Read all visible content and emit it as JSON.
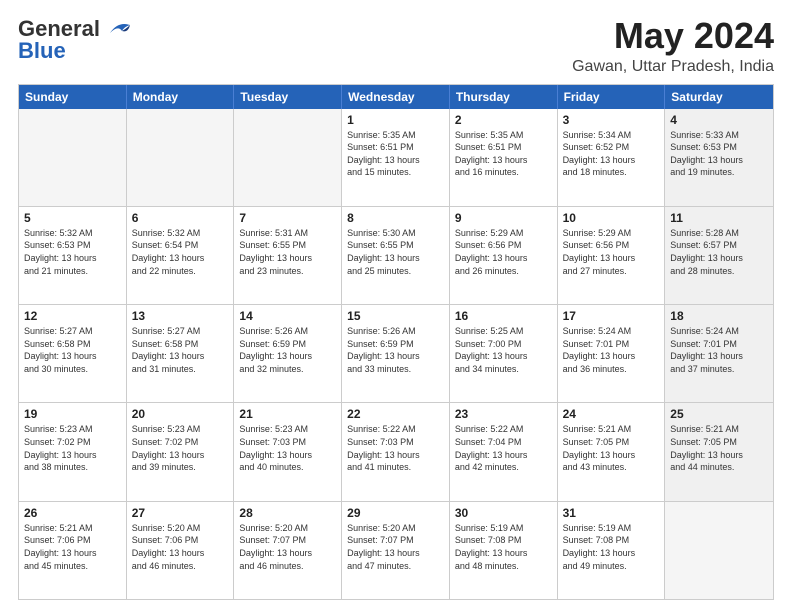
{
  "logo": {
    "line1": "General",
    "line2": "Blue"
  },
  "title": "May 2024",
  "subtitle": "Gawan, Uttar Pradesh, India",
  "weekdays": [
    "Sunday",
    "Monday",
    "Tuesday",
    "Wednesday",
    "Thursday",
    "Friday",
    "Saturday"
  ],
  "rows": [
    [
      {
        "day": "",
        "info": "",
        "empty": true
      },
      {
        "day": "",
        "info": "",
        "empty": true
      },
      {
        "day": "",
        "info": "",
        "empty": true
      },
      {
        "day": "1",
        "info": "Sunrise: 5:35 AM\nSunset: 6:51 PM\nDaylight: 13 hours\nand 15 minutes.",
        "empty": false
      },
      {
        "day": "2",
        "info": "Sunrise: 5:35 AM\nSunset: 6:51 PM\nDaylight: 13 hours\nand 16 minutes.",
        "empty": false
      },
      {
        "day": "3",
        "info": "Sunrise: 5:34 AM\nSunset: 6:52 PM\nDaylight: 13 hours\nand 18 minutes.",
        "empty": false
      },
      {
        "day": "4",
        "info": "Sunrise: 5:33 AM\nSunset: 6:53 PM\nDaylight: 13 hours\nand 19 minutes.",
        "empty": false,
        "shaded": true
      }
    ],
    [
      {
        "day": "5",
        "info": "Sunrise: 5:32 AM\nSunset: 6:53 PM\nDaylight: 13 hours\nand 21 minutes.",
        "empty": false
      },
      {
        "day": "6",
        "info": "Sunrise: 5:32 AM\nSunset: 6:54 PM\nDaylight: 13 hours\nand 22 minutes.",
        "empty": false
      },
      {
        "day": "7",
        "info": "Sunrise: 5:31 AM\nSunset: 6:55 PM\nDaylight: 13 hours\nand 23 minutes.",
        "empty": false
      },
      {
        "day": "8",
        "info": "Sunrise: 5:30 AM\nSunset: 6:55 PM\nDaylight: 13 hours\nand 25 minutes.",
        "empty": false
      },
      {
        "day": "9",
        "info": "Sunrise: 5:29 AM\nSunset: 6:56 PM\nDaylight: 13 hours\nand 26 minutes.",
        "empty": false
      },
      {
        "day": "10",
        "info": "Sunrise: 5:29 AM\nSunset: 6:56 PM\nDaylight: 13 hours\nand 27 minutes.",
        "empty": false
      },
      {
        "day": "11",
        "info": "Sunrise: 5:28 AM\nSunset: 6:57 PM\nDaylight: 13 hours\nand 28 minutes.",
        "empty": false,
        "shaded": true
      }
    ],
    [
      {
        "day": "12",
        "info": "Sunrise: 5:27 AM\nSunset: 6:58 PM\nDaylight: 13 hours\nand 30 minutes.",
        "empty": false
      },
      {
        "day": "13",
        "info": "Sunrise: 5:27 AM\nSunset: 6:58 PM\nDaylight: 13 hours\nand 31 minutes.",
        "empty": false
      },
      {
        "day": "14",
        "info": "Sunrise: 5:26 AM\nSunset: 6:59 PM\nDaylight: 13 hours\nand 32 minutes.",
        "empty": false
      },
      {
        "day": "15",
        "info": "Sunrise: 5:26 AM\nSunset: 6:59 PM\nDaylight: 13 hours\nand 33 minutes.",
        "empty": false
      },
      {
        "day": "16",
        "info": "Sunrise: 5:25 AM\nSunset: 7:00 PM\nDaylight: 13 hours\nand 34 minutes.",
        "empty": false
      },
      {
        "day": "17",
        "info": "Sunrise: 5:24 AM\nSunset: 7:01 PM\nDaylight: 13 hours\nand 36 minutes.",
        "empty": false
      },
      {
        "day": "18",
        "info": "Sunrise: 5:24 AM\nSunset: 7:01 PM\nDaylight: 13 hours\nand 37 minutes.",
        "empty": false,
        "shaded": true
      }
    ],
    [
      {
        "day": "19",
        "info": "Sunrise: 5:23 AM\nSunset: 7:02 PM\nDaylight: 13 hours\nand 38 minutes.",
        "empty": false
      },
      {
        "day": "20",
        "info": "Sunrise: 5:23 AM\nSunset: 7:02 PM\nDaylight: 13 hours\nand 39 minutes.",
        "empty": false
      },
      {
        "day": "21",
        "info": "Sunrise: 5:23 AM\nSunset: 7:03 PM\nDaylight: 13 hours\nand 40 minutes.",
        "empty": false
      },
      {
        "day": "22",
        "info": "Sunrise: 5:22 AM\nSunset: 7:03 PM\nDaylight: 13 hours\nand 41 minutes.",
        "empty": false
      },
      {
        "day": "23",
        "info": "Sunrise: 5:22 AM\nSunset: 7:04 PM\nDaylight: 13 hours\nand 42 minutes.",
        "empty": false
      },
      {
        "day": "24",
        "info": "Sunrise: 5:21 AM\nSunset: 7:05 PM\nDaylight: 13 hours\nand 43 minutes.",
        "empty": false
      },
      {
        "day": "25",
        "info": "Sunrise: 5:21 AM\nSunset: 7:05 PM\nDaylight: 13 hours\nand 44 minutes.",
        "empty": false,
        "shaded": true
      }
    ],
    [
      {
        "day": "26",
        "info": "Sunrise: 5:21 AM\nSunset: 7:06 PM\nDaylight: 13 hours\nand 45 minutes.",
        "empty": false
      },
      {
        "day": "27",
        "info": "Sunrise: 5:20 AM\nSunset: 7:06 PM\nDaylight: 13 hours\nand 46 minutes.",
        "empty": false
      },
      {
        "day": "28",
        "info": "Sunrise: 5:20 AM\nSunset: 7:07 PM\nDaylight: 13 hours\nand 46 minutes.",
        "empty": false
      },
      {
        "day": "29",
        "info": "Sunrise: 5:20 AM\nSunset: 7:07 PM\nDaylight: 13 hours\nand 47 minutes.",
        "empty": false
      },
      {
        "day": "30",
        "info": "Sunrise: 5:19 AM\nSunset: 7:08 PM\nDaylight: 13 hours\nand 48 minutes.",
        "empty": false
      },
      {
        "day": "31",
        "info": "Sunrise: 5:19 AM\nSunset: 7:08 PM\nDaylight: 13 hours\nand 49 minutes.",
        "empty": false
      },
      {
        "day": "",
        "info": "",
        "empty": true,
        "shaded": true
      }
    ]
  ]
}
